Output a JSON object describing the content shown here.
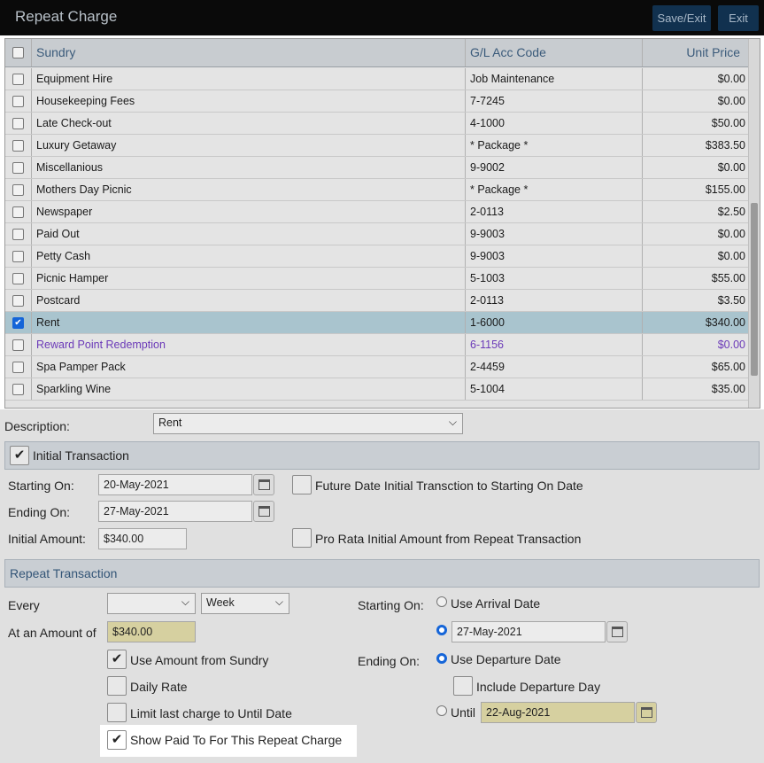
{
  "window": {
    "title": "Repeat Charge",
    "save_exit": "Save/Exit",
    "exit": "Exit"
  },
  "grid": {
    "headers": {
      "sundry": "Sundry",
      "gl": "G/L Acc Code",
      "price": "Unit Price"
    },
    "rows": [
      {
        "name": "Equipment Hire",
        "gl": "Job Maintenance",
        "price": "$0.00"
      },
      {
        "name": "Housekeeping Fees",
        "gl": "7-7245",
        "price": "$0.00"
      },
      {
        "name": "Late Check-out",
        "gl": "4-1000",
        "price": "$50.00"
      },
      {
        "name": "Luxury Getaway",
        "gl": "* Package *",
        "price": "$383.50"
      },
      {
        "name": "Miscellanious",
        "gl": "9-9002",
        "price": "$0.00"
      },
      {
        "name": "Mothers Day Picnic",
        "gl": "* Package *",
        "price": "$155.00"
      },
      {
        "name": "Newspaper",
        "gl": "2-0113",
        "price": "$2.50"
      },
      {
        "name": "Paid Out",
        "gl": "9-9003",
        "price": "$0.00"
      },
      {
        "name": "Petty Cash",
        "gl": "9-9003",
        "price": "$0.00"
      },
      {
        "name": "Picnic Hamper",
        "gl": "5-1003",
        "price": "$55.00"
      },
      {
        "name": "Postcard",
        "gl": "2-0113",
        "price": "$3.50"
      },
      {
        "name": "Rent",
        "gl": "1-6000",
        "price": "$340.00"
      },
      {
        "name": "Reward Point Redemption",
        "gl": "6-1156",
        "price": "$0.00"
      },
      {
        "name": "Spa Pamper Pack",
        "gl": "2-4459",
        "price": "$65.00"
      },
      {
        "name": "Sparkling Wine",
        "gl": "5-1004",
        "price": "$35.00"
      }
    ]
  },
  "description": {
    "label": "Description:",
    "value": "Rent"
  },
  "initial": {
    "section": "Initial Transaction",
    "starting_label": "Starting On:",
    "starting_value": "20-May-2021",
    "ending_label": "Ending On:",
    "ending_value": "27-May-2021",
    "amount_label": "Initial Amount:",
    "amount_value": "$340.00",
    "future_label": "Future Date Initial Transction to Starting On Date",
    "prorata_label": "Pro Rata Initial Amount from Repeat Transaction"
  },
  "repeat": {
    "section": "Repeat Transaction",
    "every_label": "Every",
    "every_value": "",
    "period_value": "Week",
    "amount_label": "At an Amount of",
    "amount_value": "$340.00",
    "use_amount": "Use Amount from Sundry",
    "daily_rate": "Daily Rate",
    "limit_last": "Limit last charge to Until Date",
    "show_paid": "Show Paid To For This Repeat Charge",
    "starting_label": "Starting On:",
    "use_arrival": "Use Arrival Date",
    "start_date": "27-May-2021",
    "ending_label": "Ending On:",
    "use_departure": "Use Departure Date",
    "include_departure": "Include Departure Day",
    "until_label": "Until",
    "until_date": "22-Aug-2021"
  }
}
